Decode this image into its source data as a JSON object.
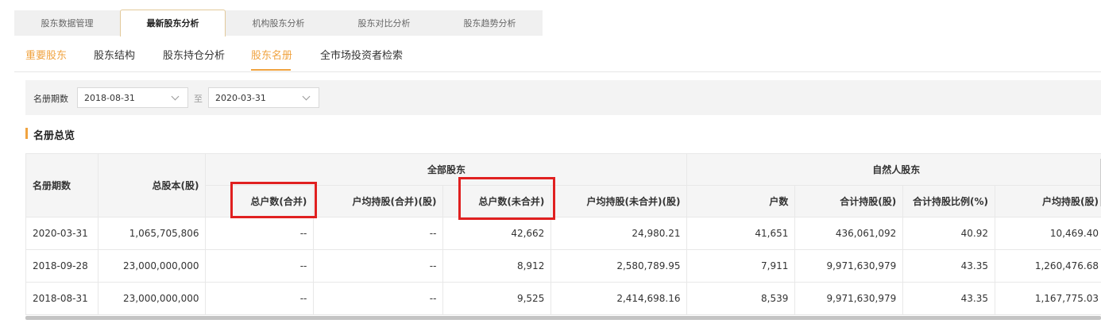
{
  "top_tabs": [
    "股东数据管理",
    "最新股东分析",
    "机构股东分析",
    "股东对比分析",
    "股东趋势分析"
  ],
  "sub_tabs": [
    "重要股东",
    "股东结构",
    "股东持仓分析",
    "股东名册",
    "全市场投资者检索"
  ],
  "filter": {
    "label": "名册期数",
    "from": "2018-08-31",
    "to_label": "至",
    "to": "2020-03-31"
  },
  "section_title": "名册总览",
  "table": {
    "col_period": "名册期数",
    "col_total_shares": "总股本(股)",
    "group_all": "全部股东",
    "group_natural": "自然人股东",
    "all_cols": [
      "总户数(合并)",
      "户均持股(合并)(股)",
      "总户数(未合并)",
      "户均持股(未合并)(股)"
    ],
    "natural_cols": [
      "户数",
      "合计持股(股)",
      "合计持股比例(%)",
      "户均持股(股)"
    ],
    "rows": [
      [
        "2020-03-31",
        "1,065,705,806",
        "--",
        "--",
        "42,662",
        "24,980.21",
        "41,651",
        "436,061,092",
        "40.92",
        "10,469.40"
      ],
      [
        "2018-09-28",
        "23,000,000,000",
        "--",
        "--",
        "8,912",
        "2,580,789.95",
        "7,911",
        "9,971,630,979",
        "43.35",
        "1,260,476.68"
      ],
      [
        "2018-08-31",
        "23,000,000,000",
        "--",
        "--",
        "9,525",
        "2,414,698.16",
        "8,539",
        "9,971,630,979",
        "43.35",
        "1,167,775.03"
      ]
    ]
  },
  "colors": {
    "accent": "#f0a340",
    "highlight_box": "#e02020",
    "header_bg": "#f5f5f5"
  }
}
